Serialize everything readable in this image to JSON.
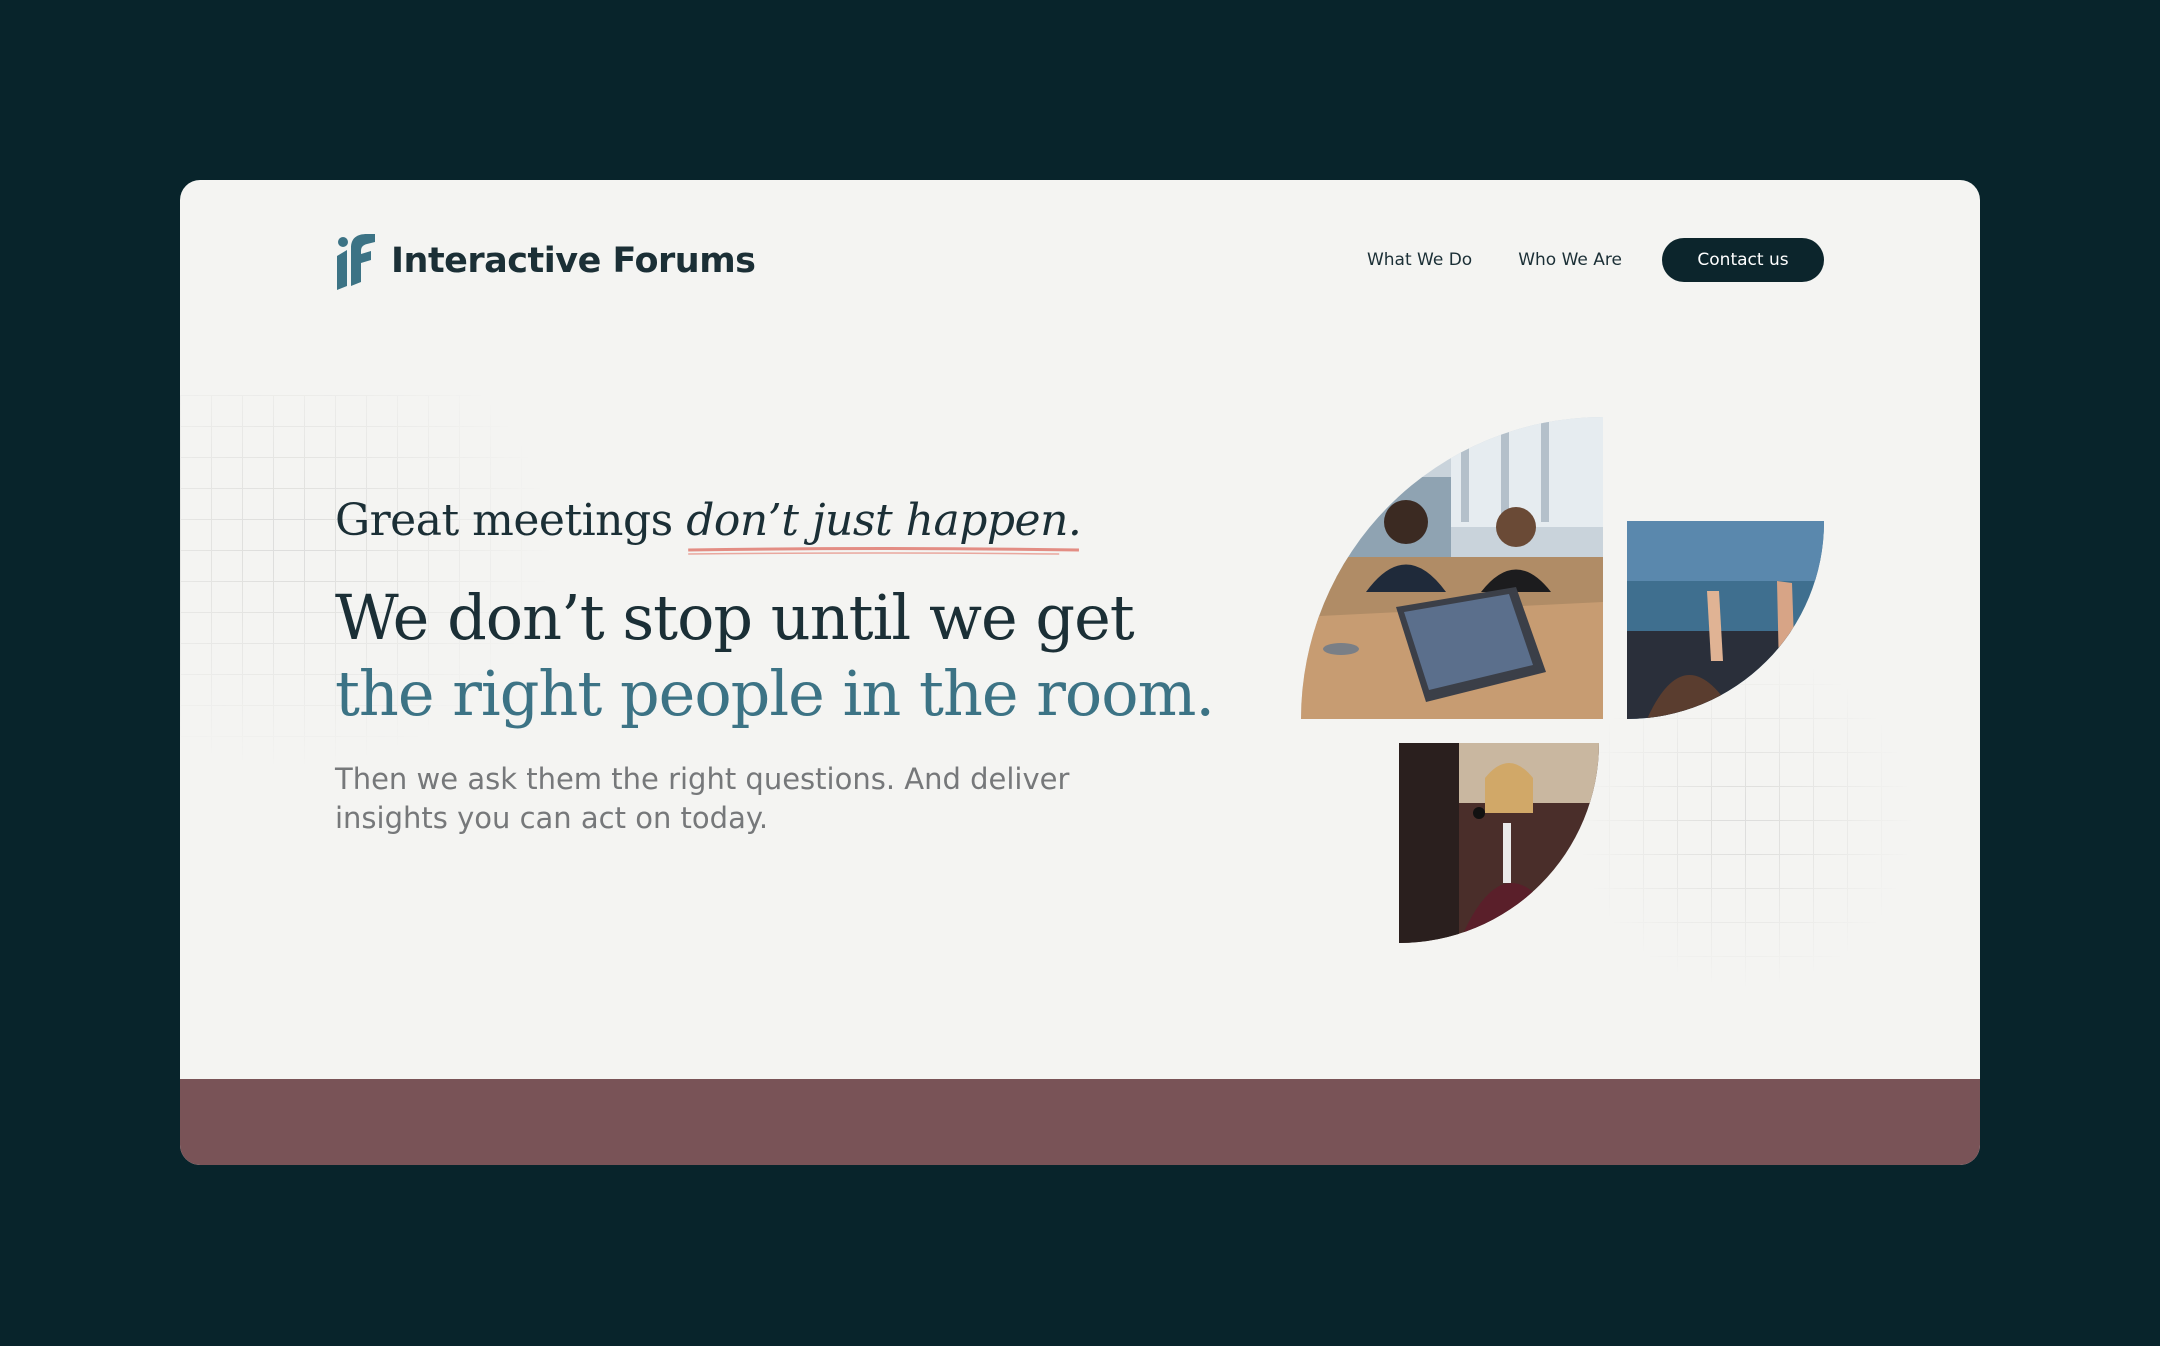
{
  "brand": {
    "name": "Interactive Forums",
    "logo_icon": "if-monogram-icon",
    "accent_color": "#3c7385",
    "dark_color": "#0c252c",
    "band_color": "#795357"
  },
  "nav": {
    "items": [
      {
        "label": "What We Do"
      },
      {
        "label": "Who We Are"
      }
    ],
    "contact_label": "Contact us"
  },
  "hero": {
    "tagline_plain": "Great meetings ",
    "tagline_italic": "don’t just happen.",
    "headline_line1": "We don’t stop until we get",
    "headline_line2": "the right people in the room.",
    "subtext": "Then we ask them the right questions. And deliver insights you can act on today."
  },
  "images": [
    {
      "name": "meeting-table-photo"
    },
    {
      "name": "raised-hands-photo"
    },
    {
      "name": "speaker-microphone-photo"
    }
  ]
}
